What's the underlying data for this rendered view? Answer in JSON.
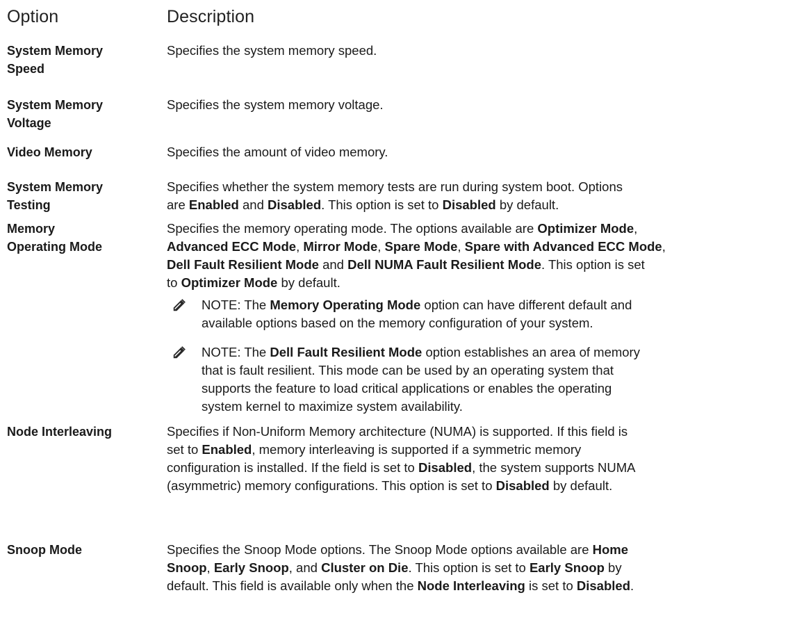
{
  "header": {
    "option": "Option",
    "description": "Description"
  },
  "rows": [
    {
      "term": [
        "System Memory",
        "Speed"
      ],
      "desc": [
        [
          [
            "Specifies the system memory speed.",
            false
          ]
        ]
      ]
    },
    {
      "term": [
        "System Memory",
        "Voltage"
      ],
      "desc": [
        [
          [
            "Specifies the system memory voltage.",
            false
          ]
        ]
      ]
    },
    {
      "term": [
        "Video Memory"
      ],
      "desc": [
        [
          [
            "Specifies the amount of video memory.",
            false
          ]
        ]
      ]
    },
    {
      "term": [
        "System Memory",
        "Testing"
      ],
      "desc": [
        [
          [
            "Specifies whether the system memory tests are run during system boot. Options",
            false
          ]
        ],
        [
          [
            "are ",
            false
          ],
          [
            "Enabled",
            true
          ],
          [
            " and ",
            false
          ],
          [
            "Disabled",
            true
          ],
          [
            ". This option is set to ",
            false
          ],
          [
            "Disabled",
            true
          ],
          [
            " by default.",
            false
          ]
        ]
      ]
    },
    {
      "term": [
        "Memory",
        "Operating Mode"
      ],
      "desc": [
        [
          [
            "Specifies the memory operating mode. The options available are ",
            false
          ],
          [
            "Optimizer Mode",
            true
          ],
          [
            ",",
            false
          ]
        ],
        [
          [
            "Advanced ECC Mode",
            true
          ],
          [
            ", ",
            false
          ],
          [
            "Mirror Mode",
            true
          ],
          [
            ", ",
            false
          ],
          [
            "Spare Mode",
            true
          ],
          [
            ", ",
            false
          ],
          [
            "Spare with Advanced ECC Mode",
            true
          ],
          [
            ",",
            false
          ]
        ],
        [
          [
            "Dell Fault Resilient Mode",
            true
          ],
          [
            " and ",
            false
          ],
          [
            "Dell NUMA Fault Resilient Mode",
            true
          ],
          [
            ". This option is set",
            false
          ]
        ],
        [
          [
            "to ",
            false
          ],
          [
            "Optimizer Mode",
            true
          ],
          [
            " by default.",
            false
          ]
        ]
      ],
      "notes": [
        [
          [
            [
              "NOTE: ",
              false
            ],
            [
              "The ",
              false
            ],
            [
              "Memory Operating Mode",
              true
            ],
            [
              " option can have different default and",
              false
            ]
          ],
          [
            [
              "available options based on the memory configuration of your system.",
              false
            ]
          ]
        ],
        [
          [
            [
              "NOTE: ",
              false
            ],
            [
              "The ",
              false
            ],
            [
              "Dell Fault Resilient Mode",
              true
            ],
            [
              " option establishes an area of memory",
              false
            ]
          ],
          [
            [
              "that is fault resilient. This mode can be used by an operating system that",
              false
            ]
          ],
          [
            [
              "supports the feature to load critical applications or enables the operating",
              false
            ]
          ],
          [
            [
              "system kernel to maximize system availability.",
              false
            ]
          ]
        ]
      ]
    },
    {
      "term": [
        "Node Interleaving"
      ],
      "desc": [
        [
          [
            "Specifies if Non-Uniform Memory architecture (NUMA) is supported. If this field is",
            false
          ]
        ],
        [
          [
            "set to ",
            false
          ],
          [
            "Enabled",
            true
          ],
          [
            ", memory interleaving is supported if a symmetric memory",
            false
          ]
        ],
        [
          [
            "configuration is installed. If the field is set to ",
            false
          ],
          [
            "Disabled",
            true
          ],
          [
            ", the system supports NUMA",
            false
          ]
        ],
        [
          [
            "(asymmetric) memory configurations. This option is set to ",
            false
          ],
          [
            "Disabled",
            true
          ],
          [
            " by default.",
            false
          ]
        ]
      ]
    },
    {
      "term": [
        "Snoop Mode"
      ],
      "desc": [
        [
          [
            "Specifies the Snoop Mode options. The Snoop Mode options available are ",
            false
          ],
          [
            "Home",
            true
          ]
        ],
        [
          [
            "Snoop",
            true
          ],
          [
            ", ",
            false
          ],
          [
            "Early Snoop",
            true
          ],
          [
            ", and ",
            false
          ],
          [
            "Cluster on Die",
            true
          ],
          [
            ". This option is set to ",
            false
          ],
          [
            "Early Snoop",
            true
          ],
          [
            " by",
            false
          ]
        ],
        [
          [
            "default. This field is available only when the ",
            false
          ],
          [
            "Node Interleaving",
            true
          ],
          [
            " is set to ",
            false
          ],
          [
            "Disabled",
            true
          ],
          [
            ".",
            false
          ]
        ]
      ]
    }
  ]
}
